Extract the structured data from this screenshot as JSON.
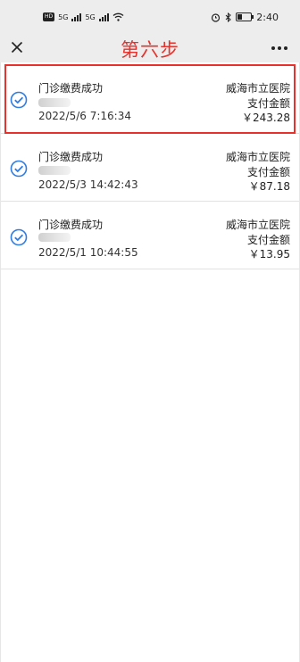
{
  "status_bar": {
    "network_left": "HD",
    "signal_1": "5G",
    "signal_2": "5G",
    "time": "2:40"
  },
  "nav": {
    "title": "第六步"
  },
  "records": [
    {
      "title": "门诊缴费成功",
      "date": "2022/5/6 7:16:34",
      "hospital": "威海市立医院",
      "label": "支付金额",
      "amount": "￥243.28",
      "highlighted": true
    },
    {
      "title": "门诊缴费成功",
      "date": "2022/5/3 14:42:43",
      "hospital": "威海市立医院",
      "label": "支付金额",
      "amount": "￥87.18",
      "highlighted": false
    },
    {
      "title": "门诊缴费成功",
      "date": "2022/5/1 10:44:55",
      "hospital": "威海市立医院",
      "label": "支付金额",
      "amount": "￥13.95",
      "highlighted": false
    }
  ],
  "colors": {
    "accent_red": "#e8312a",
    "check_blue": "#2f7de1",
    "bar_gray": "#ededed"
  }
}
